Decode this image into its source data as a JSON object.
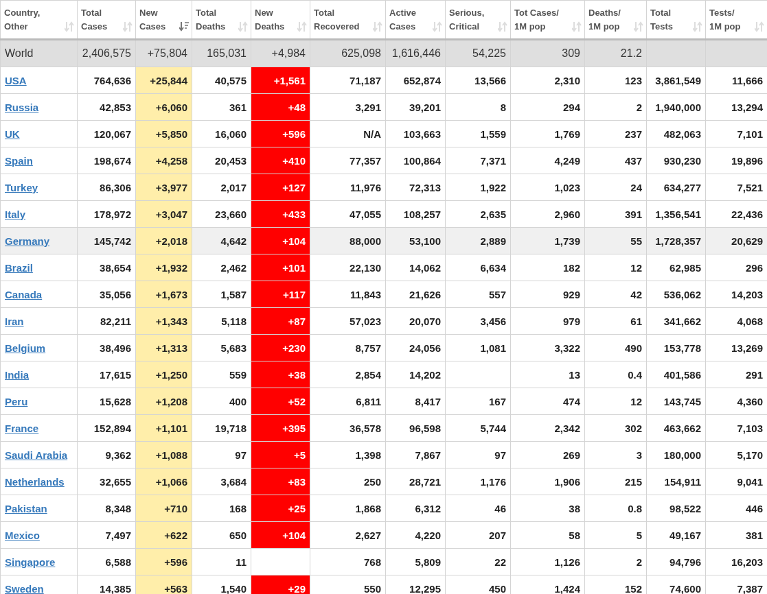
{
  "table": {
    "columns": [
      {
        "label": "Country,\nOther",
        "sorted": false
      },
      {
        "label": "Total\nCases",
        "sorted": false
      },
      {
        "label": "New\nCases",
        "sorted": true
      },
      {
        "label": "Total\nDeaths",
        "sorted": false
      },
      {
        "label": "New\nDeaths",
        "sorted": false
      },
      {
        "label": "Total\nRecovered",
        "sorted": false
      },
      {
        "label": "Active\nCases",
        "sorted": false
      },
      {
        "label": "Serious,\nCritical",
        "sorted": false
      },
      {
        "label": "Tot Cases/\n1M pop",
        "sorted": false
      },
      {
        "label": "Deaths/\n1M pop",
        "sorted": false
      },
      {
        "label": "Total\nTests",
        "sorted": false
      },
      {
        "label": "Tests/\n1M pop",
        "sorted": false
      }
    ],
    "rows": [
      {
        "kind": "total",
        "highlighted": false,
        "cells": [
          "World",
          "2,406,575",
          "+75,804",
          "165,031",
          "+4,984",
          "625,098",
          "1,616,446",
          "54,225",
          "309",
          "21.2",
          null,
          null
        ]
      },
      {
        "kind": "country",
        "highlighted": false,
        "cells": [
          "USA",
          "764,636",
          "+25,844",
          "40,575",
          "+1,561",
          "71,187",
          "652,874",
          "13,566",
          "2,310",
          "123",
          "3,861,549",
          "11,666"
        ]
      },
      {
        "kind": "country",
        "highlighted": false,
        "cells": [
          "Russia",
          "42,853",
          "+6,060",
          "361",
          "+48",
          "3,291",
          "39,201",
          "8",
          "294",
          "2",
          "1,940,000",
          "13,294"
        ]
      },
      {
        "kind": "country",
        "highlighted": false,
        "cells": [
          "UK",
          "120,067",
          "+5,850",
          "16,060",
          "+596",
          "N/A",
          "103,663",
          "1,559",
          "1,769",
          "237",
          "482,063",
          "7,101"
        ]
      },
      {
        "kind": "country",
        "highlighted": false,
        "cells": [
          "Spain",
          "198,674",
          "+4,258",
          "20,453",
          "+410",
          "77,357",
          "100,864",
          "7,371",
          "4,249",
          "437",
          "930,230",
          "19,896"
        ]
      },
      {
        "kind": "country",
        "highlighted": false,
        "cells": [
          "Turkey",
          "86,306",
          "+3,977",
          "2,017",
          "+127",
          "11,976",
          "72,313",
          "1,922",
          "1,023",
          "24",
          "634,277",
          "7,521"
        ]
      },
      {
        "kind": "country",
        "highlighted": false,
        "cells": [
          "Italy",
          "178,972",
          "+3,047",
          "23,660",
          "+433",
          "47,055",
          "108,257",
          "2,635",
          "2,960",
          "391",
          "1,356,541",
          "22,436"
        ]
      },
      {
        "kind": "country",
        "highlighted": true,
        "cells": [
          "Germany",
          "145,742",
          "+2,018",
          "4,642",
          "+104",
          "88,000",
          "53,100",
          "2,889",
          "1,739",
          "55",
          "1,728,357",
          "20,629"
        ]
      },
      {
        "kind": "country",
        "highlighted": false,
        "cells": [
          "Brazil",
          "38,654",
          "+1,932",
          "2,462",
          "+101",
          "22,130",
          "14,062",
          "6,634",
          "182",
          "12",
          "62,985",
          "296"
        ]
      },
      {
        "kind": "country",
        "highlighted": false,
        "cells": [
          "Canada",
          "35,056",
          "+1,673",
          "1,587",
          "+117",
          "11,843",
          "21,626",
          "557",
          "929",
          "42",
          "536,062",
          "14,203"
        ]
      },
      {
        "kind": "country",
        "highlighted": false,
        "cells": [
          "Iran",
          "82,211",
          "+1,343",
          "5,118",
          "+87",
          "57,023",
          "20,070",
          "3,456",
          "979",
          "61",
          "341,662",
          "4,068"
        ]
      },
      {
        "kind": "country",
        "highlighted": false,
        "cells": [
          "Belgium",
          "38,496",
          "+1,313",
          "5,683",
          "+230",
          "8,757",
          "24,056",
          "1,081",
          "3,322",
          "490",
          "153,778",
          "13,269"
        ]
      },
      {
        "kind": "country",
        "highlighted": false,
        "cells": [
          "India",
          "17,615",
          "+1,250",
          "559",
          "+38",
          "2,854",
          "14,202",
          null,
          "13",
          "0.4",
          "401,586",
          "291"
        ]
      },
      {
        "kind": "country",
        "highlighted": false,
        "cells": [
          "Peru",
          "15,628",
          "+1,208",
          "400",
          "+52",
          "6,811",
          "8,417",
          "167",
          "474",
          "12",
          "143,745",
          "4,360"
        ]
      },
      {
        "kind": "country",
        "highlighted": false,
        "cells": [
          "France",
          "152,894",
          "+1,101",
          "19,718",
          "+395",
          "36,578",
          "96,598",
          "5,744",
          "2,342",
          "302",
          "463,662",
          "7,103"
        ]
      },
      {
        "kind": "country",
        "highlighted": false,
        "cells": [
          "Saudi Arabia",
          "9,362",
          "+1,088",
          "97",
          "+5",
          "1,398",
          "7,867",
          "97",
          "269",
          "3",
          "180,000",
          "5,170"
        ]
      },
      {
        "kind": "country",
        "highlighted": false,
        "cells": [
          "Netherlands",
          "32,655",
          "+1,066",
          "3,684",
          "+83",
          "250",
          "28,721",
          "1,176",
          "1,906",
          "215",
          "154,911",
          "9,041"
        ]
      },
      {
        "kind": "country",
        "highlighted": false,
        "cells": [
          "Pakistan",
          "8,348",
          "+710",
          "168",
          "+25",
          "1,868",
          "6,312",
          "46",
          "38",
          "0.8",
          "98,522",
          "446"
        ]
      },
      {
        "kind": "country",
        "highlighted": false,
        "cells": [
          "Mexico",
          "7,497",
          "+622",
          "650",
          "+104",
          "2,627",
          "4,220",
          "207",
          "58",
          "5",
          "49,167",
          "381"
        ]
      },
      {
        "kind": "country",
        "highlighted": false,
        "cells": [
          "Singapore",
          "6,588",
          "+596",
          "11",
          null,
          "768",
          "5,809",
          "22",
          "1,126",
          "2",
          "94,796",
          "16,203"
        ]
      },
      {
        "kind": "country",
        "highlighted": false,
        "cells": [
          "Sweden",
          "14,385",
          "+563",
          "1,540",
          "+29",
          "550",
          "12,295",
          "450",
          "1,424",
          "152",
          "74,600",
          "7,387"
        ]
      }
    ]
  }
}
